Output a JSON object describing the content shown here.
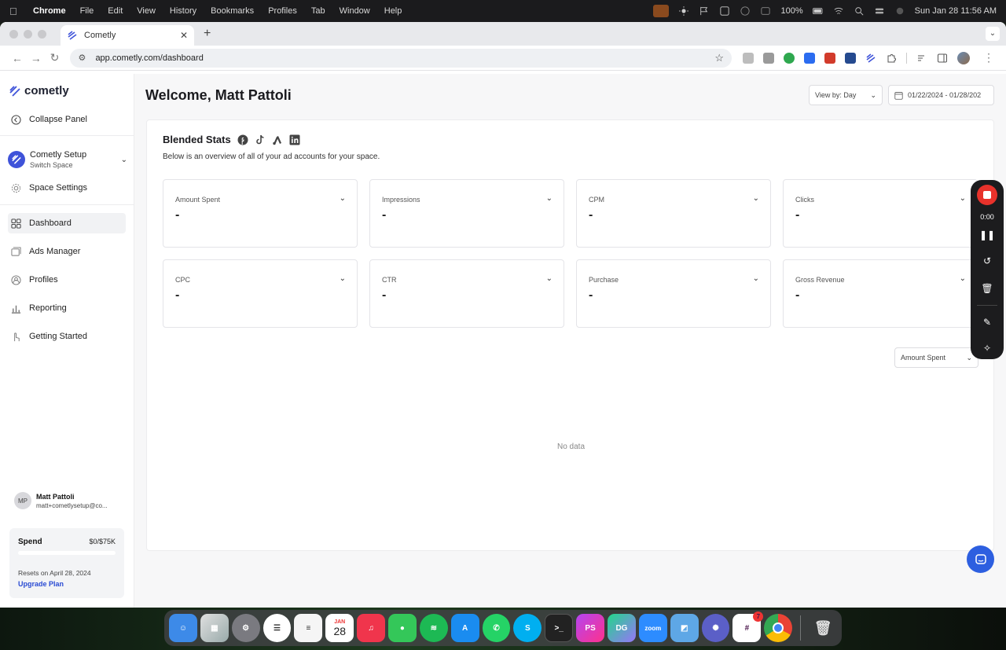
{
  "menubar": {
    "app_name": "Chrome",
    "items": [
      "File",
      "Edit",
      "View",
      "History",
      "Bookmarks",
      "Profiles",
      "Tab",
      "Window",
      "Help"
    ],
    "battery": "100%",
    "clock": "Sun Jan 28  11:56 AM"
  },
  "browser": {
    "tab_title": "Cometly",
    "url": "app.cometly.com/dashboard"
  },
  "sidebar": {
    "logo": "cometly",
    "collapse": "Collapse Panel",
    "space_name": "Cometly Setup",
    "space_sub": "Switch Space",
    "space_settings": "Space Settings",
    "nav": [
      {
        "label": "Dashboard",
        "icon": "grid-icon",
        "active": true
      },
      {
        "label": "Ads Manager",
        "icon": "window-icon",
        "active": false
      },
      {
        "label": "Profiles",
        "icon": "user-circle-icon",
        "active": false
      },
      {
        "label": "Reporting",
        "icon": "bar-chart-icon",
        "active": false
      },
      {
        "label": "Getting Started",
        "icon": "pointer-icon",
        "active": false
      }
    ],
    "user": {
      "initials": "MP",
      "name": "Matt Pattoli",
      "email": "matt+cometlysetup@co..."
    },
    "spend": {
      "label": "Spend",
      "value": "$0/$75K",
      "progress": 0,
      "resets": "Resets on April 28, 2024",
      "upgrade": "Upgrade Plan"
    }
  },
  "main": {
    "welcome": "Welcome, Matt Pattoli",
    "view_by": "View by: Day",
    "date_range": "01/22/2024 - 01/28/202",
    "panel_title": "Blended Stats",
    "panel_subtitle": "Below is an overview of all of your ad accounts for your space.",
    "platform_icons": [
      "facebook-icon",
      "tiktok-icon",
      "google-ads-icon",
      "linkedin-icon"
    ],
    "metrics": [
      {
        "label": "Amount Spent",
        "value": "-"
      },
      {
        "label": "Impressions",
        "value": "-"
      },
      {
        "label": "CPM",
        "value": "-"
      },
      {
        "label": "Clicks",
        "value": "-"
      },
      {
        "label": "CPC",
        "value": "-"
      },
      {
        "label": "CTR",
        "value": "-"
      },
      {
        "label": "Purchase",
        "value": "-"
      },
      {
        "label": "Gross Revenue",
        "value": "-"
      }
    ],
    "chart_metric": "Amount Spent",
    "no_data": "No data"
  },
  "recorder": {
    "time": "0:00"
  },
  "dock": {
    "calendar_month": "JAN",
    "calendar_day": "28",
    "slack_badge": "7",
    "zoom_label": "zoom",
    "apps": [
      "finder",
      "launchpad",
      "system-settings",
      "reminders",
      "notes",
      "calendar",
      "music",
      "messages",
      "spotify",
      "app-store",
      "whatsapp",
      "skype",
      "terminal",
      "phpstorm",
      "datagrip",
      "zoom",
      "preview",
      "perplexity",
      "slack",
      "chrome",
      "trash"
    ]
  },
  "colors": {
    "brand": "#3f53d9",
    "record": "#e8322b",
    "chat": "#2d5fe0"
  }
}
